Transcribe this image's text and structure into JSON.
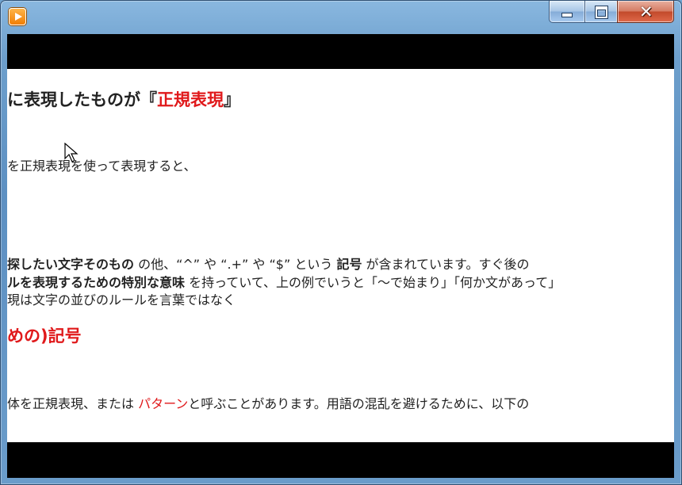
{
  "window": {
    "app_icon": "media-player-icon"
  },
  "controls": {
    "minimize": "minimize-icon",
    "maximize": "maximize-icon",
    "close": "close-icon"
  },
  "content": {
    "heading1": {
      "a": "に表現したものが『",
      "b": "正規表現",
      "c": "』"
    },
    "line2": "を正規表現を使って表現すると、",
    "para1": {
      "a": "探したい文字そのもの",
      "b": " の他、“^” や “.+” や “$” という ",
      "c": "記号",
      "d": " が含まれています。すぐ後の"
    },
    "para2": {
      "a": "ルを表現するための特別な意味",
      "b": " を持っていて、上の例でいうと「～で始まり」「何か文があって」"
    },
    "para3": "現は文字の並びのルールを言葉ではなく",
    "heading2": "めの)記号",
    "para4": {
      "a": "体を正規表現、または ",
      "b": "パターン",
      "c": "と呼ぶことがあります。用語の混乱を避けるために、以下の"
    }
  }
}
